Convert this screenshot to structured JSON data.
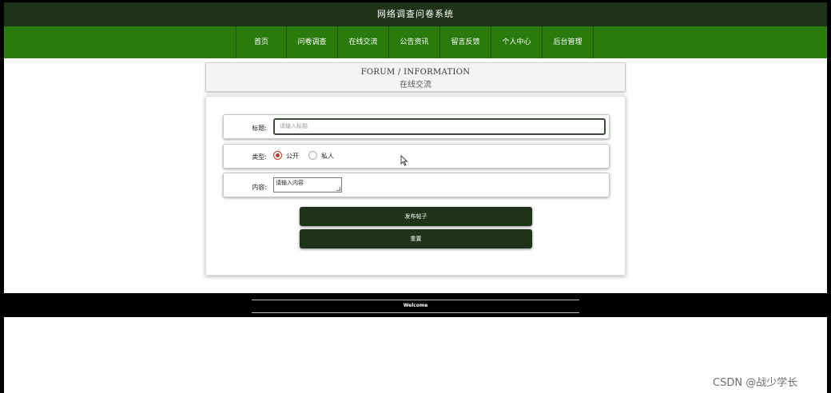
{
  "header": {
    "title": "网络调查问卷系统"
  },
  "nav": {
    "items": [
      "首页",
      "问卷调查",
      "在线交流",
      "公告资讯",
      "留言反馈",
      "个人中心",
      "后台管理"
    ]
  },
  "banner": {
    "en": "FORUM / INFORMATION",
    "zh": "在线交流"
  },
  "form": {
    "title_label": "标题:",
    "title_placeholder": "请输入标题",
    "type_label": "类型:",
    "type_options": [
      "公开",
      "私人"
    ],
    "type_selected": "公开",
    "content_label": "内容:",
    "content_value": "请输入内容",
    "submit_label": "发布帖子",
    "reset_label": "重置"
  },
  "footer": {
    "text": "Welcome"
  },
  "watermark": "CSDN @战少学长",
  "colors": {
    "header_bg": "#1e3318",
    "nav_bg": "#2a7a0e",
    "button_bg": "#1e3318",
    "radio_checked": "#c0392b"
  }
}
